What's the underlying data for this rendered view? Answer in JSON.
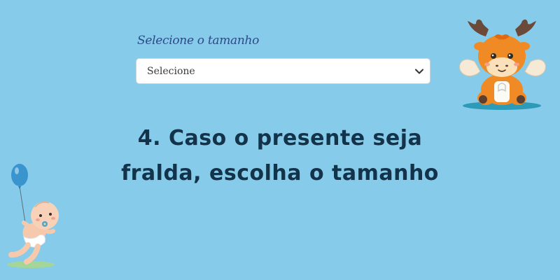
{
  "form": {
    "size_label": "Selecione o tamanho",
    "size_select": {
      "selected": "Selecione",
      "icon": "chevron-down-icon"
    }
  },
  "instruction": {
    "text": "4. Caso o presente seja fralda, escolha o tamanho"
  },
  "decorations": {
    "top_right": "moose-illustration",
    "bottom_left": "baby-with-balloon-illustration"
  },
  "colors": {
    "background": "#87cbea",
    "label": "#2b4a86",
    "heading": "#13334a"
  }
}
